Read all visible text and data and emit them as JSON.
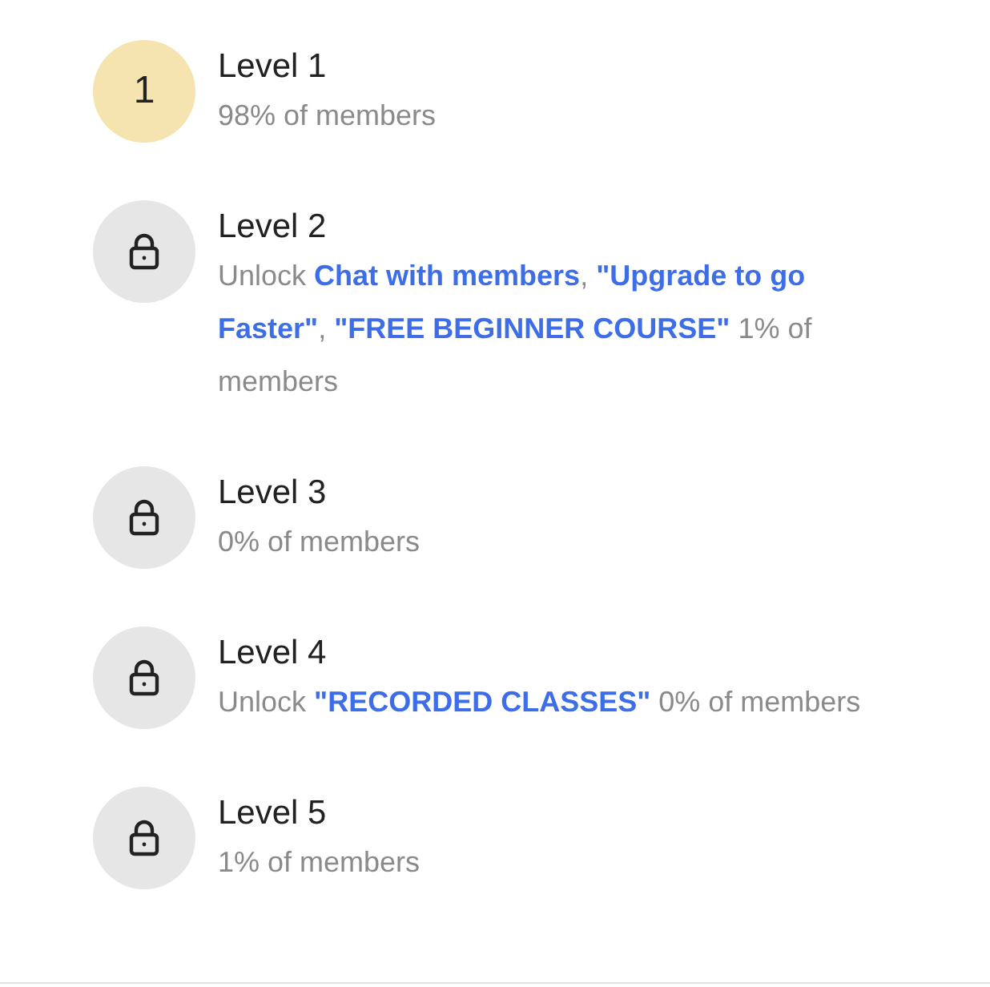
{
  "levels": [
    {
      "badge": {
        "kind": "number",
        "text": "1"
      },
      "title": "Level 1",
      "description": "98% of members"
    },
    {
      "badge": {
        "kind": "locked"
      },
      "title": "Level 2",
      "description": "Unlock **Chat with members**, **\"Upgrade to go Faster\"**, **\"FREE BEGINNER COURSE\"** 1% of members"
    },
    {
      "badge": {
        "kind": "locked"
      },
      "title": "Level 3",
      "description": "0% of members"
    },
    {
      "badge": {
        "kind": "locked"
      },
      "title": "Level 4",
      "description": "Unlock **\"RECORDED CLASSES\"** 0% of members"
    },
    {
      "badge": {
        "kind": "locked"
      },
      "title": "Level 5",
      "description": "1% of members"
    }
  ]
}
